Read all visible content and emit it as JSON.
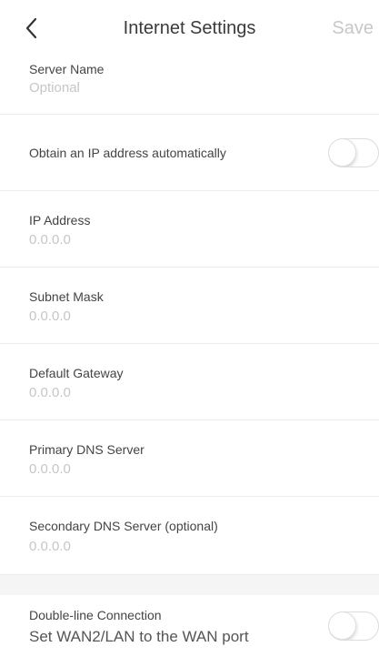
{
  "header": {
    "title": "Internet Settings",
    "save_label": "Save",
    "back_icon": "chevron-left-icon"
  },
  "server": {
    "label": "Server Name",
    "placeholder": "Optional"
  },
  "auto_ip": {
    "label": "Obtain an IP address automatically",
    "enabled": false
  },
  "fields": [
    {
      "label": "IP Address",
      "placeholder": "0.0.0.0"
    },
    {
      "label": "Subnet Mask",
      "placeholder": "0.0.0.0"
    },
    {
      "label": "Default Gateway",
      "placeholder": "0.0.0.0"
    },
    {
      "label": "Primary DNS Server",
      "placeholder": "0.0.0.0"
    },
    {
      "label": "Secondary DNS Server (optional)",
      "placeholder": "0.0.0.0"
    }
  ],
  "double_line": {
    "label": "Double-line Connection",
    "description": "Set WAN2/LAN to the WAN port",
    "enabled": false
  }
}
